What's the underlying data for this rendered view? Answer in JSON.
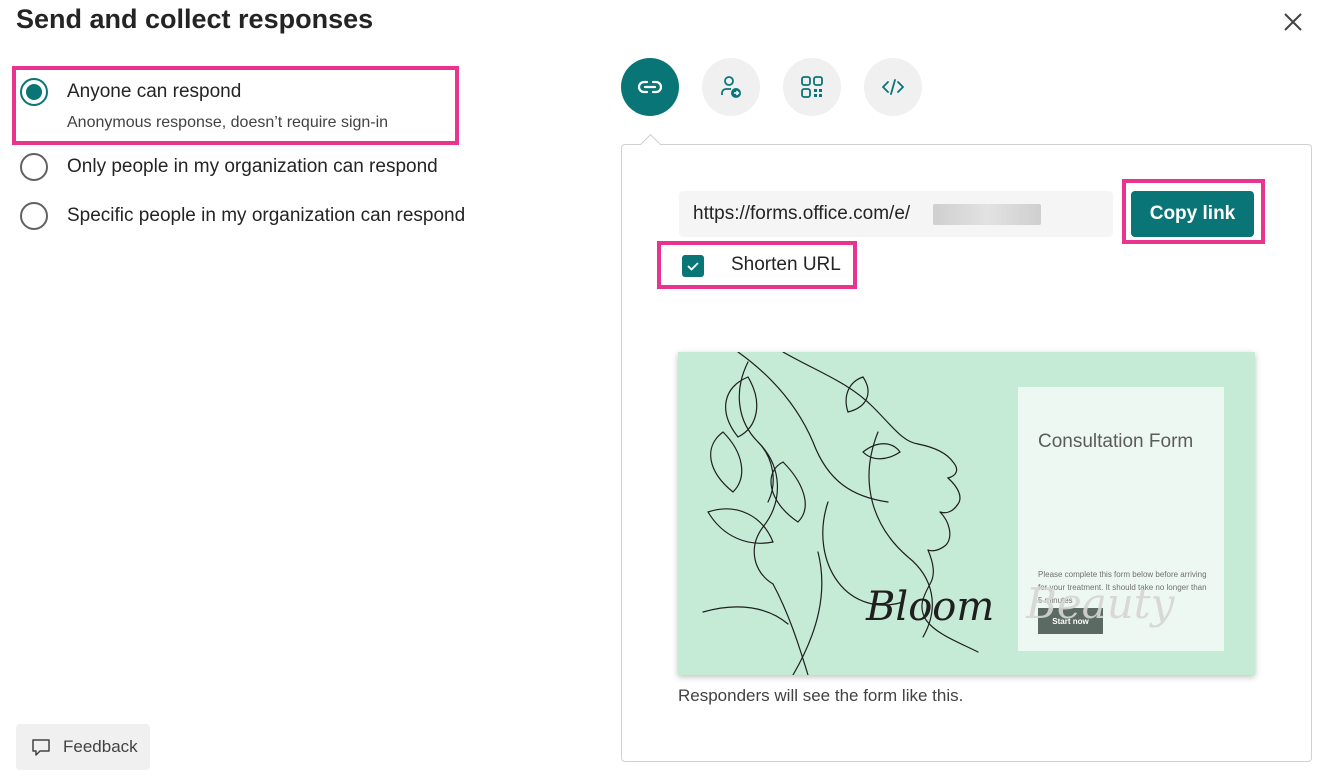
{
  "dialog": {
    "title": "Send and collect responses",
    "close_icon": "close-icon"
  },
  "options": [
    {
      "label": "Anyone can respond",
      "sublabel": "Anonymous response, doesn’t require sign-in",
      "selected": true
    },
    {
      "label": "Only people in my organization can respond",
      "selected": false
    },
    {
      "label": "Specific people in my organization can respond",
      "selected": false
    }
  ],
  "share_tabs": [
    {
      "icon": "link-icon",
      "active": true
    },
    {
      "icon": "share-people-icon",
      "active": false
    },
    {
      "icon": "qr-code-icon",
      "active": false
    },
    {
      "icon": "embed-code-icon",
      "active": false
    }
  ],
  "link_panel": {
    "url": "https://forms.office.com/e/",
    "copy_label": "Copy link",
    "shorten_label": "Shorten URL",
    "shorten_checked": true,
    "preview_hint": "Responders will see the form like this."
  },
  "preview": {
    "form_title": "Consultation Form",
    "description": "Please complete this form below before arriving for your treatment. It should take no longer than 5 minutes",
    "start_label": "Start now",
    "script_text_1": "Bloom",
    "script_text_2": "Beauty"
  },
  "footer": {
    "feedback_label": "Feedback",
    "feedback_icon": "comment-icon"
  },
  "colors": {
    "accent": "#0a7577",
    "highlight": "#e8338f",
    "preview_bg": "#c5ead6"
  }
}
